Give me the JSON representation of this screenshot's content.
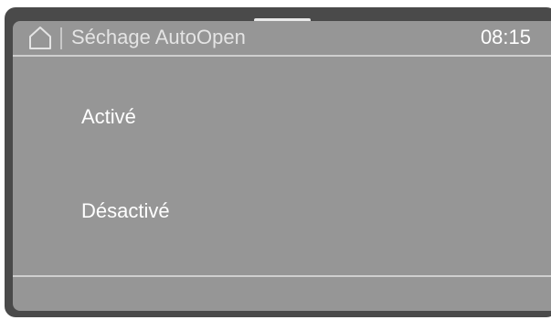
{
  "header": {
    "home_icon": "home-icon",
    "title": "Séchage AutoOpen",
    "time": "08:15"
  },
  "options": [
    {
      "label": "Activé"
    },
    {
      "label": "Désactivé"
    }
  ],
  "colors": {
    "bezel": "#4a4a4a",
    "screen": "#969696",
    "text": "#ffffff",
    "divider": "#cfcfcf"
  }
}
